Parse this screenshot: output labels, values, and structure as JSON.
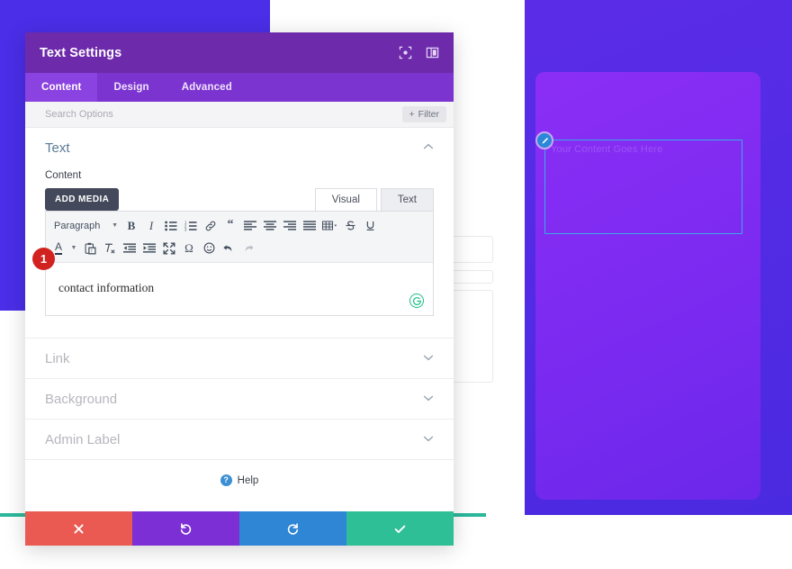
{
  "background": {
    "module_placeholder_text": "Your Content Goes Here",
    "edit_icon": "pencil-icon",
    "panel_color": "#8b2ef5",
    "outline_color": "#3aa9e8"
  },
  "modal": {
    "title": "Text Settings",
    "header_icons": [
      {
        "name": "focus-target-icon",
        "label": "Focus"
      },
      {
        "name": "panel-layout-icon",
        "label": "Layout"
      }
    ],
    "tabs": [
      {
        "label": "Content",
        "active": true
      },
      {
        "label": "Design",
        "active": false
      },
      {
        "label": "Advanced",
        "active": false
      }
    ],
    "search": {
      "placeholder": "Search Options",
      "value": ""
    },
    "filter_button": {
      "label": "Filter",
      "icon": "plus-icon"
    },
    "sections": {
      "text": {
        "title": "Text",
        "expanded": true,
        "chevron": "chevron-up-icon",
        "content_label": "Content",
        "add_media_label": "ADD MEDIA",
        "editor_tabs": [
          {
            "label": "Visual",
            "active": true
          },
          {
            "label": "Text",
            "active": false
          }
        ],
        "format_select": {
          "value": "Paragraph"
        },
        "toolbar_row_1": [
          {
            "name": "bold-icon",
            "label": "Bold"
          },
          {
            "name": "italic-icon",
            "label": "Italic"
          },
          {
            "name": "bulleted-list-icon",
            "label": "Bulleted list"
          },
          {
            "name": "numbered-list-icon",
            "label": "Numbered list"
          },
          {
            "name": "link-icon",
            "label": "Insert link"
          },
          {
            "name": "blockquote-icon",
            "label": "Blockquote"
          },
          {
            "name": "align-left-icon",
            "label": "Align left"
          },
          {
            "name": "align-center-icon",
            "label": "Align center"
          },
          {
            "name": "align-right-icon",
            "label": "Align right"
          },
          {
            "name": "align-justify-icon",
            "label": "Justify"
          },
          {
            "name": "table-icon",
            "label": "Table"
          },
          {
            "name": "strikethrough-icon",
            "label": "Strikethrough"
          },
          {
            "name": "underline-icon",
            "label": "Underline"
          }
        ],
        "toolbar_row_2": [
          {
            "name": "text-color-icon",
            "label": "Text color"
          },
          {
            "name": "paste-as-text-icon",
            "label": "Paste as text"
          },
          {
            "name": "clear-formatting-icon",
            "label": "Clear formatting"
          },
          {
            "name": "outdent-icon",
            "label": "Decrease indent"
          },
          {
            "name": "indent-icon",
            "label": "Increase indent"
          },
          {
            "name": "fullscreen-icon",
            "label": "Fullscreen"
          },
          {
            "name": "special-character-icon",
            "label": "Special character"
          },
          {
            "name": "emoji-icon",
            "label": "Emoji"
          },
          {
            "name": "undo-icon",
            "label": "Undo"
          },
          {
            "name": "redo-icon",
            "label": "Redo"
          }
        ],
        "editor_value": "contact information",
        "grammar_icon": "grammarly-icon"
      },
      "collapsed": [
        {
          "label": "Link",
          "chevron": "chevron-down-icon"
        },
        {
          "label": "Background",
          "chevron": "chevron-down-icon"
        },
        {
          "label": "Admin Label",
          "chevron": "chevron-down-icon"
        }
      ]
    },
    "help": {
      "label": "Help",
      "icon": "question-mark-icon"
    },
    "footer_buttons": [
      {
        "name": "cancel-button",
        "icon": "close-x-icon",
        "color": "#ea5a52"
      },
      {
        "name": "undo-button",
        "icon": "undo-arrow-icon",
        "color": "#7b2fd4"
      },
      {
        "name": "redo-button",
        "icon": "redo-arrow-icon",
        "color": "#2f86d4"
      },
      {
        "name": "save-button",
        "icon": "checkmark-icon",
        "color": "#2fbf96"
      }
    ]
  },
  "annotation": {
    "step_badge": "1",
    "badge_color": "#d1221f"
  }
}
